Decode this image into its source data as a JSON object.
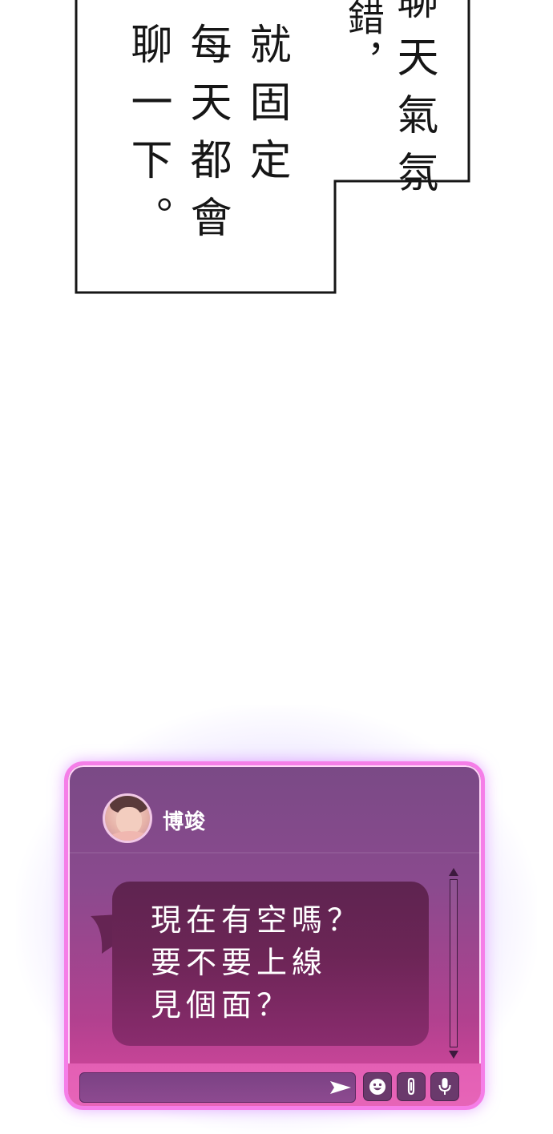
{
  "speech": {
    "columns": [
      {
        "text": "聊天氣氛"
      },
      {
        "text": "錯，"
      },
      {
        "text": "就固定"
      },
      {
        "text": "每天都會"
      },
      {
        "text": "聊一下。"
      }
    ]
  },
  "chat": {
    "contact_name": "博竣",
    "message_lines": [
      "現在有空嗎？",
      "要不要上線",
      "見個面？"
    ],
    "input_placeholder": "",
    "icons": {
      "send": "send-icon",
      "emoji": "emoji-icon",
      "attach": "paperclip-icon",
      "mic": "microphone-icon"
    },
    "colors": {
      "border": "#f57ee8",
      "window_top": "#7a4a86",
      "window_bottom": "#d9479e",
      "bubble": "#6c2556",
      "text": "#ffffff"
    }
  }
}
